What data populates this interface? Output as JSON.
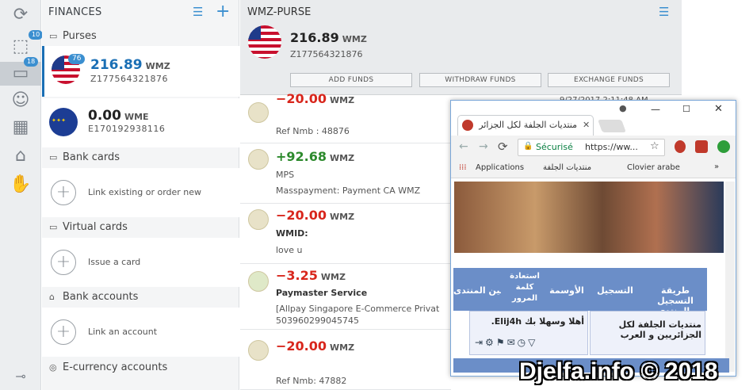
{
  "rail": {
    "badge_purses": "10",
    "badge_wallet": "18"
  },
  "finances": {
    "title": "FINANCES",
    "purses_header": "Purses",
    "bank_cards_header": "Bank cards",
    "virtual_cards_header": "Virtual cards",
    "bank_accounts_header": "Bank accounts",
    "ecurrency_header": "E-currency accounts",
    "link_card": "Link existing or order new",
    "issue_card": "Issue a card",
    "link_account": "Link an account"
  },
  "accounts": [
    {
      "amount": "216.89",
      "currency": "WMZ",
      "id": "Z177564321876",
      "badge": "76"
    },
    {
      "amount": "0.00",
      "currency": "WME",
      "id": "E170192938116"
    }
  ],
  "purse": {
    "title": "WMZ-PURSE",
    "amount": "216.89",
    "currency": "WMZ",
    "id": "Z177564321876",
    "add": "ADD FUNDS",
    "withdraw": "WITHDRAW FUNDS",
    "exchange": "EXCHANGE FUNDS",
    "date": "9/27/2017 2:11:48 AM"
  },
  "transactions": [
    {
      "amount": "−20.00",
      "cur": "WMZ",
      "line1": "",
      "line2": "Ref Nmb : 48876"
    },
    {
      "amount": "+92.68",
      "cur": "WMZ",
      "line1": "MPS",
      "line2": "Masspayment: Payment CA WMZ"
    },
    {
      "amount": "−20.00",
      "cur": "WMZ",
      "line1": "WMID: ",
      "line2": "love u"
    },
    {
      "amount": "−3.25",
      "cur": "WMZ",
      "line1": "Paymaster Service",
      "line2": "[Allpay Singapore E-Commerce Privat",
      "line3": "503960299045745"
    },
    {
      "amount": "−20.00",
      "cur": "WMZ",
      "line1": "",
      "line2": "Ref Nmb: 47882"
    }
  ],
  "browser": {
    "tab_title": "منتديات الجلفة لكل الجزائر",
    "secure": "Sécurisé",
    "url": "https://ww...",
    "bookmarks": [
      "Applications",
      "منتديات الجلفة",
      "Clovier arabe"
    ],
    "bookmark_more": "»"
  },
  "site": {
    "nav": [
      "طريقة التسجيل بالمنتدى",
      "التسجيل",
      "الأوسمة",
      "استعادة كلمة المرور",
      "قوانين المنتدى"
    ],
    "welcome": "أهلا وسهلا بك Elij4h.",
    "forum_name": "منتديات الجلفة لكل الجزائريين و العرب"
  },
  "watermark": "Djelfa.info © 2018",
  "colors": {
    "accent": "#1a6fb5",
    "negative": "#d8261c",
    "positive": "#2d8a2d"
  }
}
